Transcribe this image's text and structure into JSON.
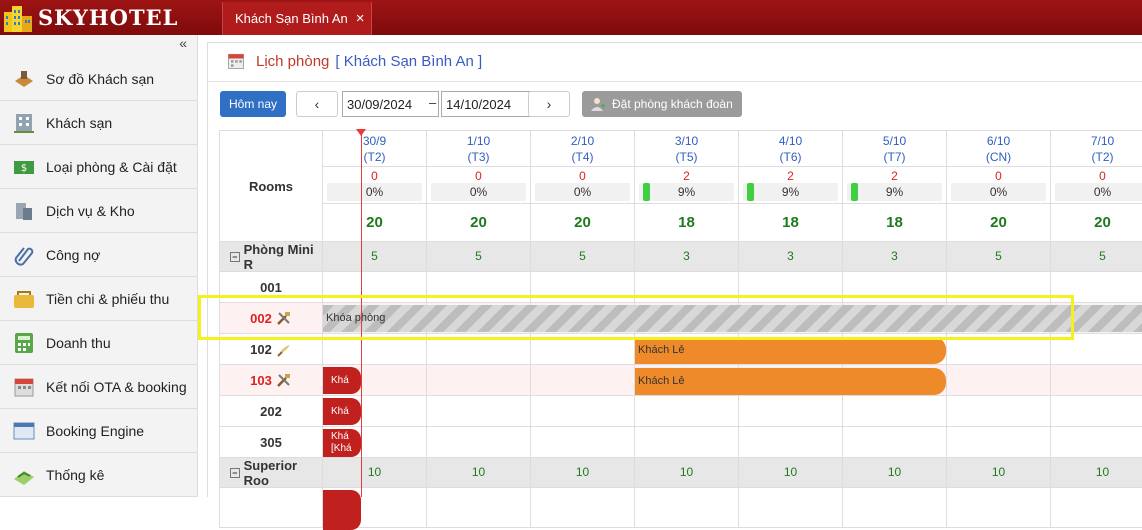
{
  "app": {
    "logo_text": "SKYHOTEL",
    "tab_label": "Khách Sạn Bình An",
    "tab_close": "×"
  },
  "sidebar": {
    "collapse": "«",
    "items": [
      {
        "label": "Sơ đồ Khách sạn",
        "icon": "hotel-map-icon"
      },
      {
        "label": "Khách sạn",
        "icon": "building-icon"
      },
      {
        "label": "Loại phòng & Cài đặt",
        "icon": "money-icon"
      },
      {
        "label": "Dịch vụ & Kho",
        "icon": "service-icon"
      },
      {
        "label": "Công nợ",
        "icon": "paperclip-icon"
      },
      {
        "label": "Tiền chi & phiếu thu",
        "icon": "wallet-icon"
      },
      {
        "label": "Doanh thu",
        "icon": "calculator-icon"
      },
      {
        "label": "Kết nối OTA & booking",
        "icon": "calendar-icon"
      },
      {
        "label": "Booking Engine",
        "icon": "window-icon"
      },
      {
        "label": "Thống kê",
        "icon": "chart-icon"
      }
    ]
  },
  "page": {
    "title": "Lịch phòng",
    "hotel": "[ Khách Sạn Bình An ]"
  },
  "toolbar": {
    "today": "Hôm nay",
    "prev": "‹",
    "next": "›",
    "from": "30/09/2024",
    "dash": "–",
    "to": "14/10/2024",
    "group_booking": "Đặt phòng khách đoàn"
  },
  "grid": {
    "rooms_header": "Rooms",
    "days": [
      {
        "date": "30/9",
        "dow": "(T2)",
        "count": "0",
        "pct": "0%",
        "avail": "20",
        "occupied": false
      },
      {
        "date": "1/10",
        "dow": "(T3)",
        "count": "0",
        "pct": "0%",
        "avail": "20",
        "occupied": false
      },
      {
        "date": "2/10",
        "dow": "(T4)",
        "count": "0",
        "pct": "0%",
        "avail": "20",
        "occupied": false
      },
      {
        "date": "3/10",
        "dow": "(T5)",
        "count": "2",
        "pct": "9%",
        "avail": "18",
        "occupied": true
      },
      {
        "date": "4/10",
        "dow": "(T6)",
        "count": "2",
        "pct": "9%",
        "avail": "18",
        "occupied": true
      },
      {
        "date": "5/10",
        "dow": "(T7)",
        "count": "2",
        "pct": "9%",
        "avail": "18",
        "occupied": true
      },
      {
        "date": "6/10",
        "dow": "(CN)",
        "count": "0",
        "pct": "0%",
        "avail": "20",
        "occupied": false
      },
      {
        "date": "7/10",
        "dow": "(T2)",
        "count": "0",
        "pct": "0%",
        "avail": "20",
        "occupied": false
      }
    ],
    "cat1": {
      "label": "Phòng Mini R",
      "nums": [
        "5",
        "5",
        "5",
        "3",
        "3",
        "3",
        "5",
        "5"
      ]
    },
    "rooms": [
      {
        "label": "001",
        "red": false
      },
      {
        "label": "002",
        "red": true
      },
      {
        "label": "102",
        "red": false
      },
      {
        "label": "103",
        "red": true
      },
      {
        "label": "202",
        "red": false
      },
      {
        "label": "305",
        "red": false
      }
    ],
    "cat2": {
      "label": "Superior Roo",
      "nums": [
        "10",
        "10",
        "10",
        "10",
        "10",
        "10",
        "10",
        "10"
      ]
    },
    "lock_label": "Khóa phòng",
    "booking_label": "Khách Lẻ",
    "short_kha": "Khá",
    "short_kha2": "[Khá"
  },
  "colors": {
    "brand": "#8b0f0f",
    "accent": "#2f6fc4",
    "booking": "#ef8a2a",
    "highlight": "#f4f21a"
  }
}
